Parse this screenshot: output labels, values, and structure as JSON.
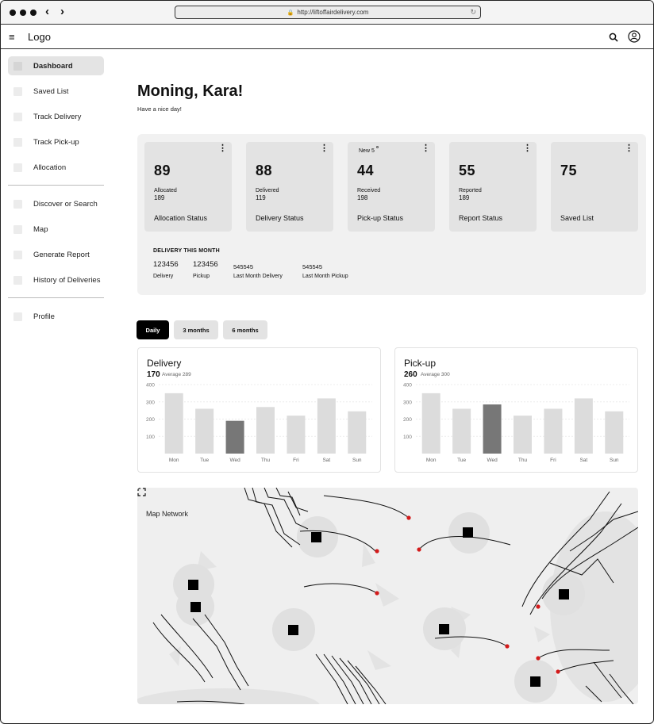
{
  "browser": {
    "url": "http://liftoffairdelivery.com"
  },
  "header": {
    "logo": "Logo"
  },
  "sidebar": {
    "items": [
      {
        "label": "Dashboard"
      },
      {
        "label": "Saved List"
      },
      {
        "label": "Track Delivery"
      },
      {
        "label": "Track Pick-up"
      },
      {
        "label": "Allocation"
      },
      {
        "label": "Discover or Search"
      },
      {
        "label": "Map"
      },
      {
        "label": "Generate Report"
      },
      {
        "label": "History of Deliveries"
      },
      {
        "label": "Profile"
      }
    ]
  },
  "greeting": {
    "title": "Moning, Kara!",
    "subtitle": "Have a nice day!"
  },
  "stats": [
    {
      "value": "89",
      "label": "Allocated",
      "sub": "189",
      "caption": "Allocation Status"
    },
    {
      "value": "88",
      "label": "Delivered",
      "sub": "119",
      "caption": "Delivery Status"
    },
    {
      "value": "44",
      "badge": "New 5",
      "label": "Received",
      "sub": "198",
      "caption": "Pick-up Status"
    },
    {
      "value": "55",
      "label": "Reported",
      "sub": "189",
      "caption": "Report Status"
    },
    {
      "value": "75",
      "caption": "Saved List"
    }
  ],
  "month": {
    "title": "DELIVERY THIS MONTH",
    "delivery": {
      "value": "123456",
      "label": "Delivery"
    },
    "pickup": {
      "value": "123456",
      "label": "Pickup"
    },
    "last_delivery": {
      "value": "545545",
      "label": "Last Month Delivery"
    },
    "last_pickup": {
      "value": "545545",
      "label": "Last Month Pickup"
    }
  },
  "range_tabs": [
    {
      "label": "Daily",
      "selected": true
    },
    {
      "label": "3 months"
    },
    {
      "label": "6 months"
    }
  ],
  "chart_data": [
    {
      "type": "bar",
      "title": "Delivery",
      "total": "170",
      "average": "Average 289",
      "categories": [
        "Mon",
        "Tue",
        "Wed",
        "Thu",
        "Fri",
        "Sat",
        "Sun"
      ],
      "values": [
        350,
        260,
        190,
        270,
        220,
        320,
        245
      ],
      "highlight_index": 2,
      "yticks": [
        "400",
        "300",
        "200",
        "100"
      ],
      "ylim": [
        0,
        400
      ],
      "colors": {
        "bar": "#dcdcdc",
        "highlight": "#777777"
      }
    },
    {
      "type": "bar",
      "title": "Pick-up",
      "total": "260",
      "average": "Average 300",
      "categories": [
        "Mon",
        "Tue",
        "Wed",
        "Thu",
        "Fri",
        "Sat",
        "Sun"
      ],
      "values": [
        350,
        260,
        285,
        220,
        260,
        320,
        245
      ],
      "highlight_index": 2,
      "yticks": [
        "400",
        "300",
        "200",
        "100"
      ],
      "ylim": [
        0,
        400
      ],
      "colors": {
        "bar": "#dcdcdc",
        "highlight": "#777777"
      }
    }
  ],
  "map": {
    "title": "Map Network"
  }
}
